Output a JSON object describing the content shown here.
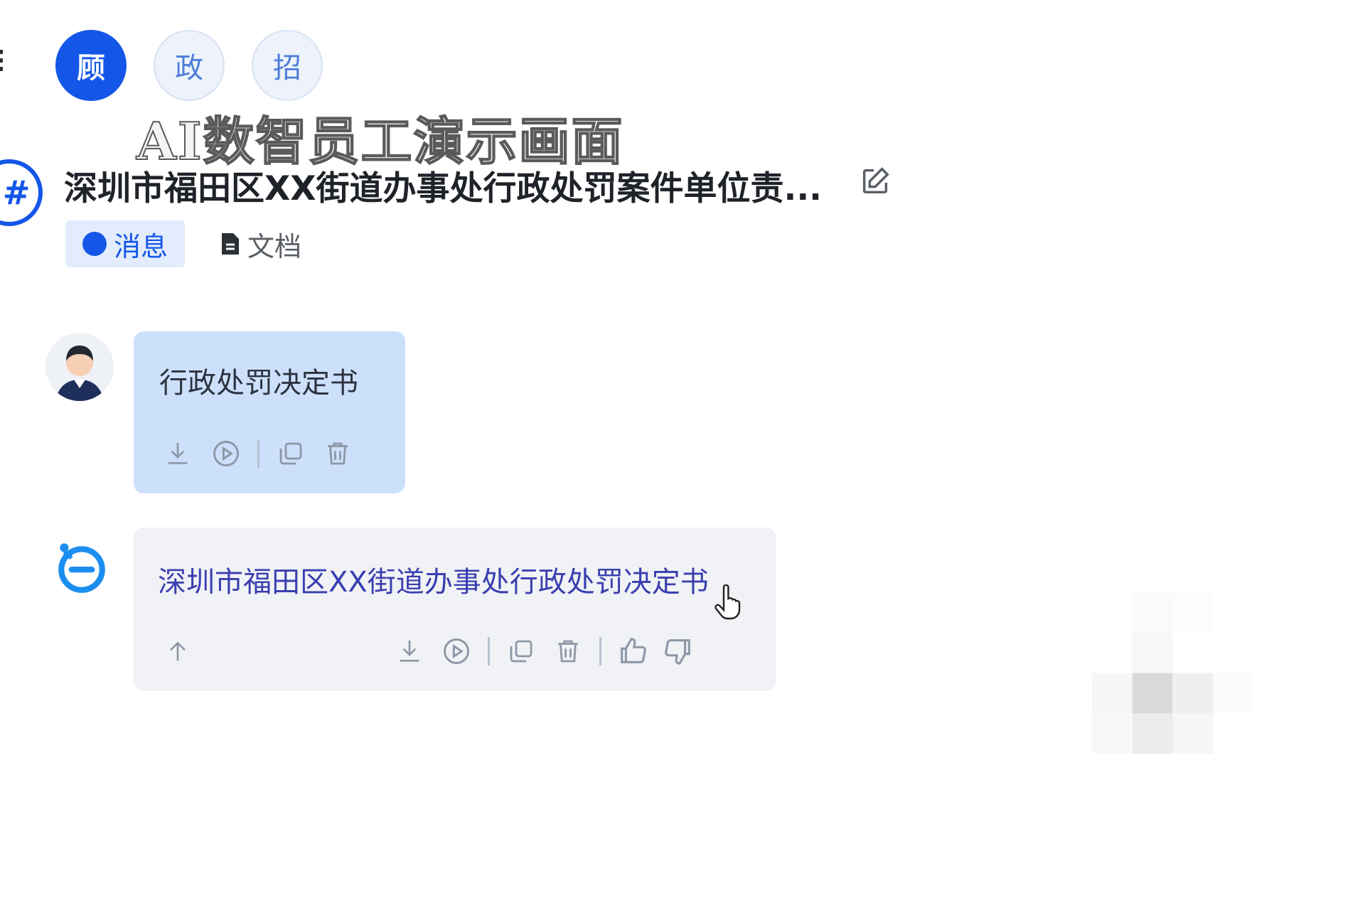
{
  "avatars": [
    {
      "label": "顾",
      "active": true
    },
    {
      "label": "政",
      "active": false
    },
    {
      "label": "招",
      "active": false
    }
  ],
  "overlay_caption": "AI数智员工演示画面",
  "channel": {
    "icon": "hash-icon",
    "title": "深圳市福田区XX街道办事处行政处罚案件单位责...",
    "edit_icon": "edit-icon"
  },
  "tabs": [
    {
      "label": "消息",
      "active": true
    },
    {
      "label": "文档",
      "active": false
    }
  ],
  "messages": [
    {
      "sender": "user",
      "text": "行政处罚决定书",
      "actions": [
        "download-icon",
        "play-icon",
        "copy-icon",
        "delete-icon"
      ]
    },
    {
      "sender": "bot",
      "link_text": "深圳市福田区XX街道办事处行政处罚决定书",
      "actions": [
        "upload-icon",
        "download-icon",
        "play-icon",
        "copy-icon",
        "delete-icon",
        "thumbs-up-icon",
        "thumbs-down-icon"
      ]
    }
  ],
  "colors": {
    "accent": "#1457e8",
    "user_bubble": "#cde0fb",
    "bot_bubble": "#f0f2f5",
    "link": "#3a3fb0"
  }
}
